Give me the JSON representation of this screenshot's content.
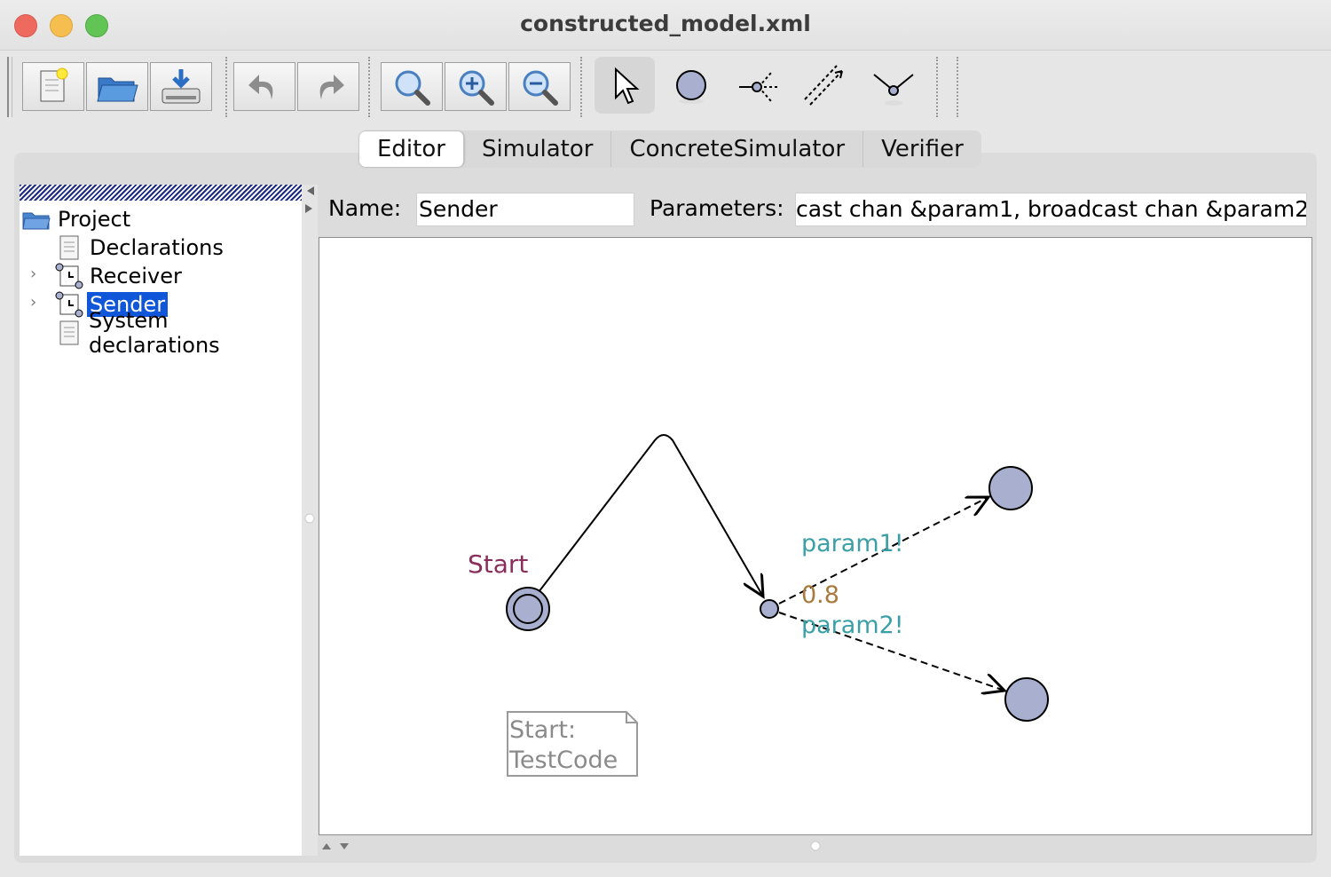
{
  "window": {
    "title": "constructed_model.xml"
  },
  "toolbar": {
    "buttons": [
      "new-document-icon",
      "open-folder-icon",
      "save-icon",
      "undo-icon",
      "redo-icon",
      "zoom-fit-icon",
      "zoom-in-icon",
      "zoom-out-icon",
      "select-tool-icon",
      "location-tool-icon",
      "branchpoint-tool-icon",
      "edge-tool-icon",
      "nail-tool-icon"
    ]
  },
  "tabs": [
    {
      "label": "Editor",
      "active": true
    },
    {
      "label": "Simulator"
    },
    {
      "label": "ConcreteSimulator"
    },
    {
      "label": "Verifier"
    }
  ],
  "tree": {
    "root": "Project",
    "items": [
      {
        "label": "Declarations",
        "icon": "document-icon"
      },
      {
        "label": "Receiver",
        "icon": "template-icon"
      },
      {
        "label": "Sender",
        "icon": "template-icon",
        "selected": true
      },
      {
        "label": "System declarations",
        "icon": "document-icon"
      }
    ]
  },
  "template": {
    "name_label": "Name:",
    "name_value": "Sender",
    "params_label": "Parameters:",
    "params_value": "cast chan &param1, broadcast chan &param2"
  },
  "diagram": {
    "start_label": "Start",
    "sync1": "param1!",
    "probability": "0.8",
    "sync2": "param2!",
    "note_line1": "Start:",
    "note_line2": "TestCode",
    "colors": {
      "location_fill": "#a9b0cf",
      "start_label": "#8b2e5c",
      "sync": "#3a9fa6",
      "probability": "#a97a3e"
    }
  }
}
